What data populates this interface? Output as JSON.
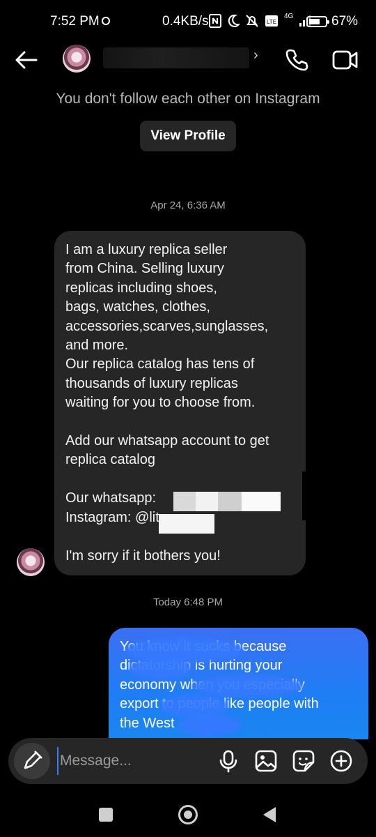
{
  "status_bar": {
    "time": "7:52 PM",
    "speed": "0.4KB/s",
    "network": "4G",
    "battery_percent": "67%",
    "battery_level": 0.67
  },
  "header": {
    "username": "",
    "icons": [
      "back-arrow-icon",
      "chevron-right-icon",
      "phone-icon",
      "video-camera-icon"
    ]
  },
  "profile_note": {
    "text": "You don't follow each other on Instagram",
    "view_profile_label": "View Profile"
  },
  "thread": {
    "timestamp_1": "Apr 24, 6:36 AM",
    "incoming_message": "I am a luxury replica seller\nfrom China. Selling luxury\nreplicas including shoes,\nbags, watches, clothes,\naccessories,scarves,sunglasses,\nand more.\nOur replica catalog has tens of\nthousands of luxury replicas\nwaiting for you to choose from.\n\nAdd our whatsapp account to get\nreplica catalog\n\nOur whatsapp:\nInstagram: @lit      nrep\n\nI'm sorry if it bothers you!",
    "timestamp_2": "Today 6:48 PM",
    "outgoing_message": "You know it sucks because\ndictatorship is hurting your\neconomy when you especially\nexport to people like people with\nthe West"
  },
  "composer": {
    "placeholder": "Message...",
    "icons": [
      "pen-icon",
      "microphone-icon",
      "photo-icon",
      "sticker-icon",
      "plus-circle-icon"
    ]
  },
  "colors": {
    "background": "#000000",
    "incoming_bubble": "#262626",
    "outgoing_bubble": "#1f7ef5",
    "secondary_text": "#a8a8a8"
  }
}
